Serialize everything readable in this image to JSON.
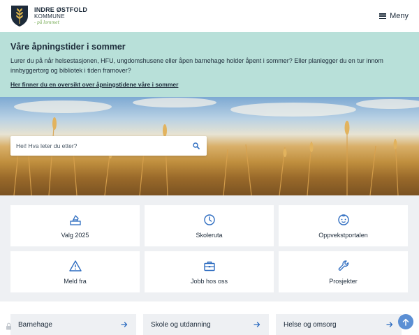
{
  "header": {
    "logo": {
      "name": "INDRE ØSTFOLD",
      "sub": "KOMMUNE",
      "tagline": "- på lommet"
    },
    "menu_label": "Meny"
  },
  "banner": {
    "title": "Våre åpningstider i sommer",
    "text": "Lurer du på når helsestasjonen, HFU, ungdomshusene eller åpen barnehage holder åpent i sommer? Eller planlegger du en tur innom innbyggertorg og bibliotek i tiden framover?",
    "link": "Her finner du en oversikt over åpningstidene våre i sommer"
  },
  "search": {
    "placeholder": "Hei! Hva leter du etter?"
  },
  "tiles": [
    {
      "label": "Valg 2025",
      "icon": "ballot-box-icon"
    },
    {
      "label": "Skoleruta",
      "icon": "clock-icon"
    },
    {
      "label": "Oppvekstportalen",
      "icon": "child-face-icon"
    },
    {
      "label": "Meld fra",
      "icon": "warning-triangle-icon"
    },
    {
      "label": "Jobb hos oss",
      "icon": "briefcase-icon"
    },
    {
      "label": "Prosjekter",
      "icon": "wrench-icon"
    }
  ],
  "categories": [
    {
      "label": "Barnehage"
    },
    {
      "label": "Skole og utdanning"
    },
    {
      "label": "Helse og omsorg"
    }
  ],
  "colors": {
    "banner_bg": "#b8e0d9",
    "text": "#1d2b3a",
    "tile_area_bg": "#eef0f3",
    "accent_blue": "#2d6cc0",
    "scroll_button": "#5b8fd4"
  }
}
